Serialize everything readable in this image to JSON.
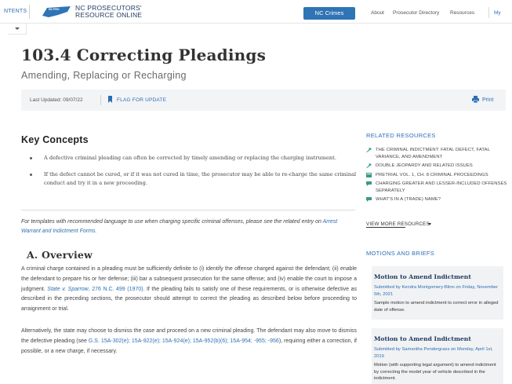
{
  "nav": {
    "contents_label": "NTENTS",
    "logo_badge": "NC PRO",
    "site_name_line1": "NC PROSECUTORS'",
    "site_name_line2": "RESOURCE ONLINE",
    "primary_button": "NC Crimes",
    "links": [
      "About",
      "Prosecutor Directory",
      "Resources"
    ],
    "account_link": "My"
  },
  "page": {
    "title": "103.4 Correcting Pleadings",
    "subtitle": "Amending, Replacing or Recharging",
    "last_updated": "Last Updated: 09/07/22",
    "flag_label": "FLAG FOR UPDATE",
    "print_label": "Print"
  },
  "key_concepts": {
    "heading": "Key Concepts",
    "items": [
      "A defective criminal pleading can often be corrected by timely amending or replacing the charging instrument.",
      "If the defect cannot be cured, or if it was not cured in time, the prosecutor may be able to re-charge the same criminal conduct and try it in a new proceeding."
    ]
  },
  "note": {
    "text_before": "For templates with recommended language to use when charging specific criminal offenses, please see the related entry on ",
    "link": "Arrest Warrant and Indictment Forms",
    "text_after": "."
  },
  "overview": {
    "heading": "A.  Overview",
    "para1_before": "A criminal charge contained in a pleading must be sufficiently definite to (i) identify the offense charged against the defendant; (ii) enable the defendant to prepare his or her defense; (iii) bar a subsequent prosecution for the same offense; and (iv) enable the court to impose a judgment. ",
    "para1_case": "State v. Sparrow",
    "para1_cite": ", 276 N.C. 499 (1970)",
    "para1_after": ". If the pleading fails to satisfy one of these requirements, or is otherwise defective as described in the preceding sections, the prosecutor should attempt to correct the pleading as described below before proceeding to arraignment or trial.",
    "para2_before": "Alternatively, the state may choose to dismiss the case and proceed on a new criminal pleading. The defendant may also move to dismiss the defective pleading (see ",
    "para2_statutes": "G.S. 15A-302(e); 15A-922(e); 15A-924(e); 15A-952(b)(6); 15A-954; -955; -956",
    "para2_after": "), requiring either a correction, if possible, or a new charge, if necessary."
  },
  "sidebar": {
    "related_heading": "RELATED RESOURCES",
    "resources": [
      {
        "icon": "gavel-icon",
        "label": "THE CRIMINAL INDICTMENT: FATAL DEFECT, FATAL VARIANCE, AND AMENDMENT"
      },
      {
        "icon": "gavel-icon",
        "label": "DOUBLE JEOPARDY AND RELATED ISSUES"
      },
      {
        "icon": "book-icon",
        "label": "PRETRIAL VOL. 1, CH. 8 CRIMINAL PROCEEDINGS"
      },
      {
        "icon": "comment-icon",
        "label": "CHARGING GREATER AND LESSER-INCLUDED OFFENSES SEPARATELY"
      },
      {
        "icon": "comment-icon",
        "label": "WHAT'S IN A (TRADE) NAME?"
      }
    ],
    "view_more": "VIEW MORE RESOURCES",
    "motions_heading": "MOTIONS AND BRIEFS",
    "cards": [
      {
        "title": "Motion to Amend Indictment",
        "submitted": "Submitted by Kendra Montgomery-Blinn on Friday, November 5th, 2021",
        "description": "Sample motion to amend indictment to correct error in alleged date of offense."
      },
      {
        "title": "Motion to Amend Indictment",
        "submitted": "Submitted by Samantha Pendergrass on Monday, April 1st, 2019",
        "description": "Motion (with supporting legal argument) to amend indictment by correcting the model year of vehicle described in the indictment."
      }
    ]
  },
  "colors": {
    "accent": "#2f74b5",
    "link": "#2c6fb3",
    "navy": "#1f3a5f",
    "meta_bg": "#f3f4f6",
    "card_bg": "#f1f2f4"
  }
}
